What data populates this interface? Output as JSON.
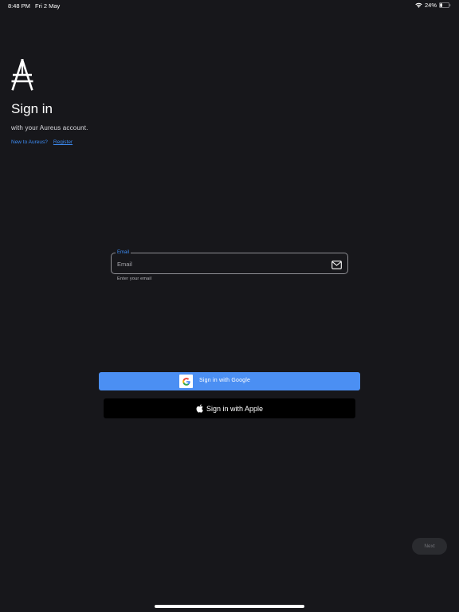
{
  "status_bar": {
    "time": "8:48 PM",
    "date": "Fri 2 May",
    "battery": "24%",
    "battery_level": 0.24
  },
  "header": {
    "logo_icon": "aureus-logo-icon",
    "title": "Sign in",
    "subtitle": "with your Aureus account.",
    "new_to_text": "New to Aureus?",
    "register_label": "Register"
  },
  "email": {
    "label": "Email",
    "placeholder": "Email",
    "value": "",
    "helper": "Enter your email",
    "icon": "mail-icon"
  },
  "buttons": {
    "google_label": "Sign in with Google",
    "apple_label": "Sign in with Apple",
    "next_label": "Next"
  },
  "colors": {
    "background": "#17171b",
    "accent": "#3d8bf2",
    "google_button": "#4b8ff3",
    "apple_button": "#000000"
  }
}
